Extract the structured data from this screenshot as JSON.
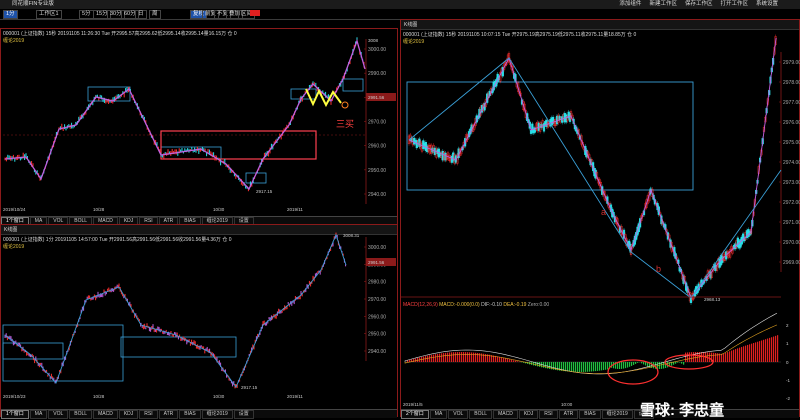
{
  "app": {
    "title": "同花顺FIN专业版"
  },
  "window_controls": [
    "添加组件",
    "新建工作区",
    "保存工作区",
    "打开工作区",
    "系统设置"
  ],
  "toolbar": {
    "tab": "工作区1",
    "periods": [
      "1分",
      "5分",
      "15分",
      "30分",
      "60分",
      "日",
      "周"
    ],
    "active_period": "1分",
    "buttons": [
      "复权",
      "前复",
      "不复",
      "叠加",
      "区间"
    ]
  },
  "panel_tl": {
    "header": "000001 (上证指数) 15秒 20191105 11:26:30 Tue  开2995.57高2995.62低2995.14收2995.14量16.15万 仓 0",
    "indicator": "缠论2019",
    "price_labels": [
      "3000.00",
      "2990.00",
      "2980.00",
      "2970.00",
      "2960.00",
      "2950.00",
      "2940.00"
    ],
    "current_price": "2991.56",
    "max_label": "3008",
    "min_label": "2917.15",
    "annotation": "三买",
    "x_dates": [
      "2019/10/24",
      "10/28",
      "10/30",
      "2019/11"
    ],
    "tabs": [
      "1个窗口",
      "MA",
      "VOL",
      "BOLL",
      "MACD",
      "KDJ",
      "RSI",
      "ATR",
      "BIAS",
      "缠论2019",
      "设置"
    ]
  },
  "panel_bl": {
    "title": "K线图",
    "header": "000001 (上证指数) 1分 20191105 14:57:00 Tue  开2991.56高2991.56低2991.56收2991.56量4.36万 仓 0",
    "indicator": "缠论2019",
    "price_labels": [
      "3000.00",
      "2990.00",
      "2980.00",
      "2970.00",
      "2960.00",
      "2950.00",
      "2940.00"
    ],
    "current_price": "2991.56",
    "max_label": "3008.31",
    "min_label": "2917.15",
    "x_dates": [
      "2019/10/23",
      "10/28",
      "10/30",
      "2019/11"
    ],
    "tabs": [
      "1个窗口",
      "MA",
      "VOL",
      "BOLL",
      "MACD",
      "KDJ",
      "RSI",
      "ATR",
      "BIAS",
      "缠论2019",
      "设置"
    ]
  },
  "panel_r": {
    "title": "K线图",
    "header": "000001 (上证指数) 15秒 20191105 10:07:15 Tue  开2975.19高2975.19低2975.11收2975.11量18.85万 仓 0",
    "indicator": "缠论2019",
    "price_labels": [
      "2979.00",
      "2978.00",
      "2977.00",
      "2976.00",
      "2975.00",
      "2974.00",
      "2973.00",
      "2972.00",
      "2971.00",
      "2970.00",
      "2969.00"
    ],
    "min_label": "2968.13",
    "label_a": "a",
    "label_b": "b",
    "macd_header": "MACD(12,26,9)",
    "macd_value": "MACD:-0.000(0.0)",
    "dif": "DIF:-0.10",
    "dea": "DEA:-0.19",
    "zero": "Zero:0.00",
    "macd_labels": [
      "2",
      "1",
      "0",
      "-1",
      "-2"
    ],
    "x_dates": [
      "2019/11/5",
      "10:00"
    ],
    "tabs": [
      "2个窗口",
      "MA",
      "VOL",
      "BOLL",
      "MACD",
      "KDJ",
      "RSI",
      "ATR",
      "BIAS",
      "缠论2019",
      "设置"
    ]
  },
  "watermark": "雪球: 李忠童",
  "colors": {
    "up": "#ff3030",
    "down": "#28e0e8",
    "wave": "#c060e0",
    "pivot": "#3aa0d8",
    "accent": "#ff4040"
  }
}
